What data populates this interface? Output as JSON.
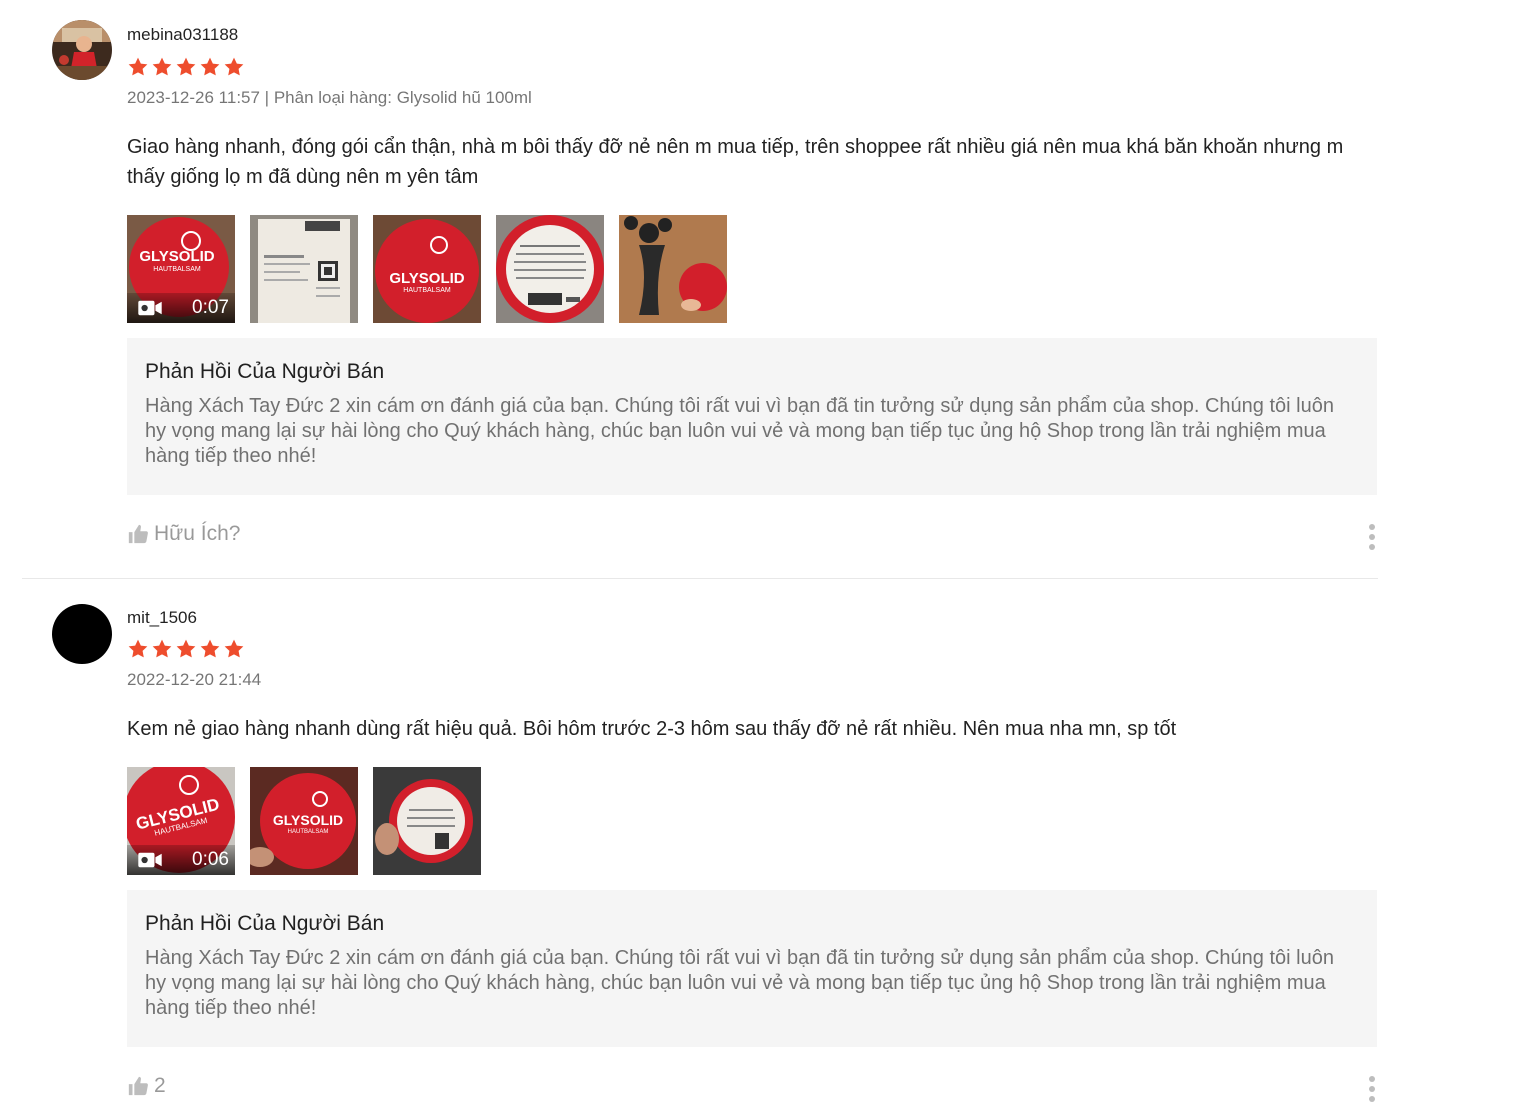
{
  "colors": {
    "star": "#ee4d2d",
    "reply_bg": "#f5f5f5",
    "product_red": "#d21f2b"
  },
  "reviews": [
    {
      "username": "mebina031188",
      "rating": 5,
      "meta": "2023-12-26 11:57 | Phân loại hàng: Glysolid hũ 100ml",
      "comment": "Giao hàng nhanh, đóng gói cẩn thận, nhà m bôi thấy đỡ nẻ nên m mua tiếp, trên shoppee rất nhiều giá nên mua khá băn khoăn nhưng m thấy giống lọ m đã dùng nên m yên tâm",
      "video_duration": "0:07",
      "media_count": 5,
      "seller_reply": {
        "title": "Phản Hồi Của Người Bán",
        "text": "Hàng Xách Tay Đức 2 xin cám ơn đánh giá của bạn. Chúng tôi rất vui vì bạn đã tin tưởng sử dụng sản phẩm của shop. Chúng tôi luôn hy vọng mang lại sự hài lòng cho Quý khách hàng, chúc bạn luôn vui vẻ và mong bạn tiếp tục ủng hộ Shop trong lần trải nghiệm mua hàng tiếp theo nhé!"
      },
      "like_label": "Hữu Ích?"
    },
    {
      "username": "mit_1506",
      "rating": 5,
      "meta": "2022-12-20 21:44",
      "comment": "Kem nẻ giao hàng nhanh dùng rất hiệu quả. Bôi hôm trước 2-3 hôm sau thấy đỡ nẻ rất nhiều. Nên mua nha mn, sp tốt",
      "video_duration": "0:06",
      "media_count": 3,
      "seller_reply": {
        "title": "Phản Hồi Của Người Bán",
        "text": "Hàng Xách Tay Đức 2 xin cám ơn đánh giá của bạn. Chúng tôi rất vui vì bạn đã tin tưởng sử dụng sản phẩm của shop. Chúng tôi luôn hy vọng mang lại sự hài lòng cho Quý khách hàng, chúc bạn luôn vui vẻ và mong bạn tiếp tục ủng hộ Shop trong lần trải nghiệm mua hàng tiếp theo nhé!"
      },
      "like_label": "2"
    }
  ],
  "icons": {
    "star": "star-icon",
    "video": "video-camera-icon",
    "like": "thumbs-up-icon",
    "more": "more-vertical-icon"
  }
}
